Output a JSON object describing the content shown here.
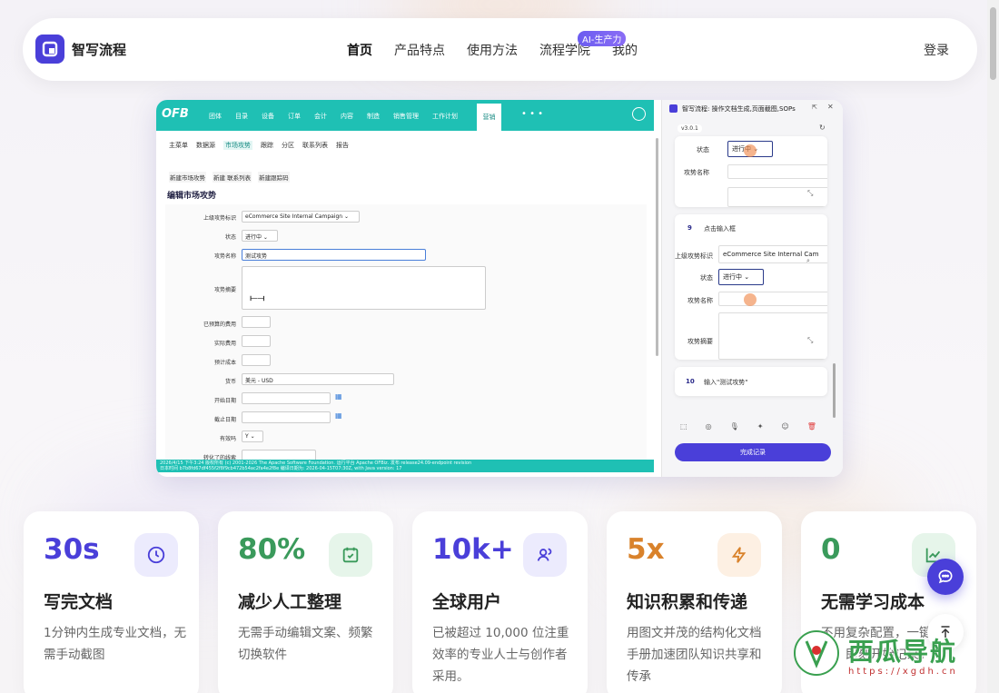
{
  "nav": {
    "brand": "智写流程",
    "links": [
      "首页",
      "产品特点",
      "使用方法",
      "流程学院",
      "我的"
    ],
    "badge": "AI-生产力",
    "login": "登录"
  },
  "ofb": {
    "logo": "OFB",
    "menu": [
      "团体",
      "目录",
      "设备",
      "订单",
      "会计",
      "内容",
      "制造",
      "销售管理",
      "工作计划"
    ],
    "active": "营销",
    "more": "• • •",
    "submenu": [
      "主菜单",
      "数据源",
      "市场攻势",
      "跟踪",
      "分区",
      "联系列表",
      "报告"
    ],
    "submenu_selected": "市场攻势",
    "quick": [
      "新建市场攻势",
      "新建 联系列表",
      "新建跟踪码"
    ],
    "form_title": "编辑市场攻势",
    "fields": [
      {
        "label": "上级攻势标识",
        "value": "eCommerce Site Internal Campaign ⌄"
      },
      {
        "label": "状态",
        "value": "进行中 ⌄"
      },
      {
        "label": "攻势名称",
        "value": "测试攻势"
      },
      {
        "label": "攻势摘要",
        "value": ""
      },
      {
        "label": "已预算的费用",
        "value": ""
      },
      {
        "label": "实际费用",
        "value": ""
      },
      {
        "label": "预计成本",
        "value": ""
      },
      {
        "label": "货币",
        "value": "美元 - USD"
      },
      {
        "label": "开始日期",
        "value": ""
      },
      {
        "label": "截止日期",
        "value": ""
      },
      {
        "label": "有效吗",
        "value": "Y ⌄"
      },
      {
        "label": "转化了的线索",
        "value": ""
      }
    ],
    "footer_line1": "2026/4/15 下午3:24   版权所有 (c) 2001-2026 The Apache Software Foundation. 运行平台 Apache OFBiz. 发布 release24.09-endpoint revision",
    "footer_line2": "日本时间   b7b8fd67df455f2f8f9cb472b54ac2fa4e2f8e  编译日期为: 2026-04-15T07:30Z, with Java version: 17"
  },
  "side": {
    "title": "智写流程: 操作文档生成,页面截图,SOPs",
    "version": "v3.0.1",
    "card1": {
      "status_label": "状态",
      "status_value": "进行中 ⌄",
      "name_label": "攻势名称"
    },
    "step9": {
      "num": "9",
      "text": "点击输入框"
    },
    "card2": {
      "parent_label": "上级攻势标识",
      "parent_value": "eCommerce Site Internal Cam",
      "status_label": "状态",
      "status_value": "进行中 ⌄",
      "name_label": "攻势名称",
      "summary_label": "攻势摘要"
    },
    "step10": {
      "num": "10",
      "text": "输入\"测试攻势\""
    },
    "done": "完成记录"
  },
  "stats": [
    {
      "num": "30s",
      "title": "写完文档",
      "desc": "1分钟内生成专业文档，无需手动截图",
      "color": "#4a3fd9",
      "icon": "clock-icon"
    },
    {
      "num": "80%",
      "title": "减少人工整理",
      "desc": "无需手动编辑文案、频繁切换软件",
      "color": "#3a9a5b",
      "icon": "calendar-check-icon"
    },
    {
      "num": "10k+",
      "title": "全球用户",
      "desc": "已被超过 10,000 位注重效率的专业人士与创作者采用。",
      "color": "#4a3fd9",
      "icon": "users-icon"
    },
    {
      "num": "5x",
      "title": "知识积累和传递",
      "desc": "用图文并茂的结构化文档手册加速团队知识共享和传承",
      "color": "#d9822b",
      "icon": "lightning-icon"
    },
    {
      "num": "0",
      "title": "无需学习成本",
      "desc": "不用复杂配置，一键即可，即刻开始记录。",
      "color": "#3a9a5b",
      "icon": "chart-line-icon"
    }
  ],
  "watermark": {
    "text": "西瓜导航",
    "url": "https://xgdh.cn"
  }
}
